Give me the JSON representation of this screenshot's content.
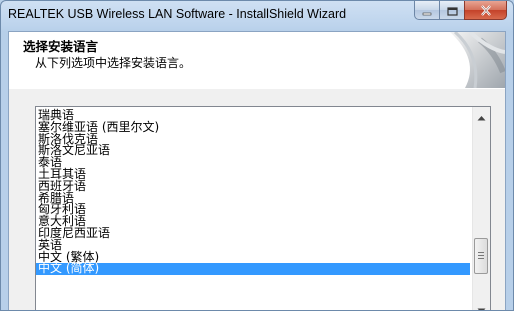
{
  "window": {
    "title": "REALTEK USB Wireless LAN Software - InstallShield Wizard"
  },
  "header": {
    "title": "选择安装语言",
    "subtitle": "从下列选项中选择安装语言。"
  },
  "languages": {
    "items": [
      "瑞典语",
      "塞尔维亚语 (西里尔文)",
      "斯洛伐克语",
      "斯洛文尼亚语",
      "泰语",
      "土耳其语",
      "西班牙语",
      "希腊语",
      "匈牙利语",
      "意大利语",
      "印度尼西亚语",
      "英语",
      "中文 (繁体)",
      "中文 (简体)"
    ],
    "selected": "中文 (简体)"
  },
  "icons": [
    "minimize-icon",
    "maximize-icon",
    "close-icon",
    "scroll-up-icon",
    "scroll-down-icon"
  ],
  "colors": {
    "selection": "#3399ff",
    "close_button": "#c4422a"
  }
}
